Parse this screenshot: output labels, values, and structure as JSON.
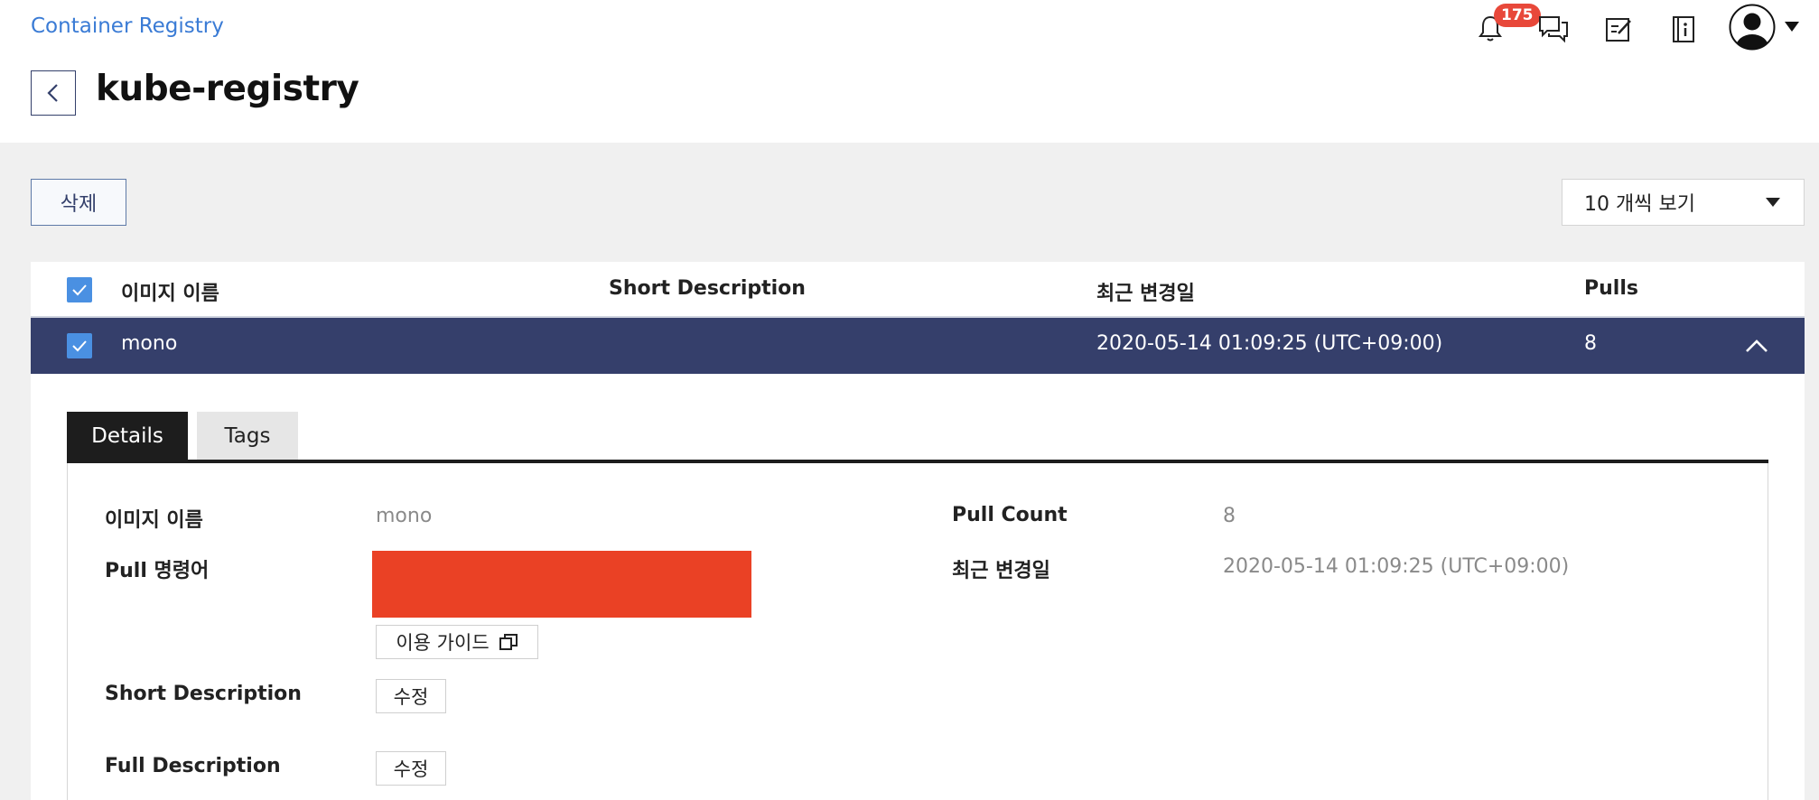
{
  "header": {
    "breadcrumb": "Container Registry",
    "title": "kube-registry",
    "notification_count": "175"
  },
  "toolbar": {
    "delete_label": "삭제",
    "page_size_label": "10 개씩 보기"
  },
  "table": {
    "columns": [
      "이미지 이름",
      "Short Description",
      "최근 변경일",
      "Pulls"
    ],
    "rows": [
      {
        "name": "mono",
        "short_description": "",
        "updated": "2020-05-14 01:09:25 (UTC+09:00)",
        "pulls": "8",
        "selected": true,
        "expanded": true
      }
    ]
  },
  "detail": {
    "tabs": [
      "Details",
      "Tags"
    ],
    "active_tab": "Details",
    "image_name_label": "이미지 이름",
    "image_name_value": "mono",
    "pull_command_label": "Pull 명령어",
    "guide_button": "이용 가이드",
    "short_desc_label": "Short Description",
    "full_desc_label": "Full Description",
    "edit_label": "수정",
    "pull_count_label": "Pull Count",
    "pull_count_value": "8",
    "updated_label": "최근 변경일",
    "updated_value": "2020-05-14 01:09:25 (UTC+09:00)"
  },
  "colors": {
    "accent_link": "#3a7bd5",
    "selected_row": "#353f6b",
    "checkbox": "#4a90e2",
    "badge": "#e8483a",
    "redaction": "#ea4125"
  },
  "icons": [
    "back-arrow-icon",
    "bell-icon",
    "chat-icon",
    "edit-note-icon",
    "info-book-icon",
    "user-avatar-icon",
    "chevron-up-icon",
    "external-window-icon",
    "checkmark-icon"
  ]
}
